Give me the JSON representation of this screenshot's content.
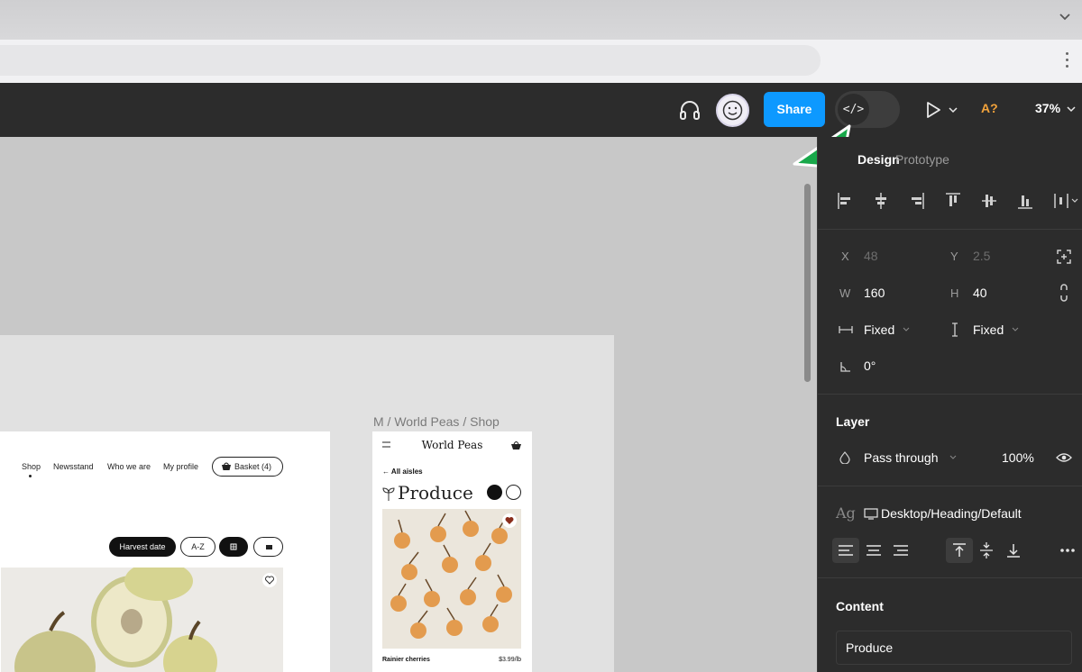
{
  "browser": {
    "tab_chevron_icon": "chevron-down-icon",
    "menu_icon": "kebab-icon"
  },
  "toolbar": {
    "share_label": "Share",
    "devmode_icon_text": "</>",
    "accessibility_label": "A?",
    "zoom": "37%",
    "accent_color": "#0d99ff"
  },
  "canvas": {
    "frame_label": "M / World Peas / Shop",
    "desktop": {
      "nav": [
        "Shop",
        "Newsstand",
        "Who we are",
        "My profile"
      ],
      "basket_label": "Basket",
      "basket_count": "(4)",
      "filter_harvest": "Harvest date",
      "filter_az": "A-Z"
    },
    "mobile": {
      "brand": "World Peas",
      "back_link": "← All aisles",
      "heading": "Produce",
      "product_name": "Rainier cherries",
      "product_price": "$3.99/lb"
    }
  },
  "panel": {
    "tabs": [
      "Design",
      "Prototype"
    ],
    "x_label": "X",
    "x_value": "48",
    "y_label": "Y",
    "y_value": "2.5",
    "w_label": "W",
    "w_value": "160",
    "h_label": "H",
    "h_value": "40",
    "width_mode": "Fixed",
    "height_mode": "Fixed",
    "rotation": "0°",
    "layer_title": "Layer",
    "blend_mode": "Pass through",
    "opacity": "100%",
    "text_style_prefix": "Ag",
    "text_style": "Desktop/Heading/Default",
    "content_title": "Content",
    "content_value": "Produce"
  }
}
